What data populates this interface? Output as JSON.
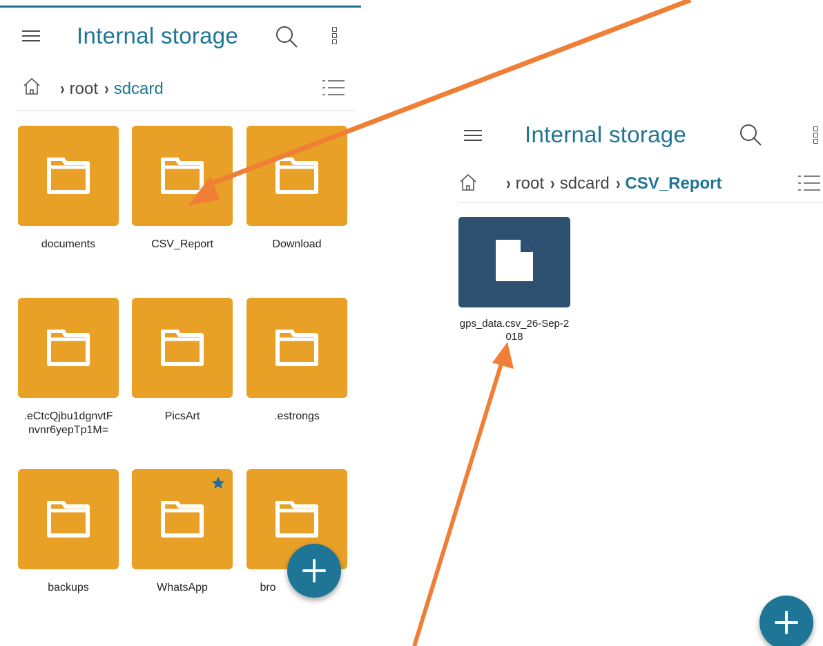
{
  "accent_color": "#1e7595",
  "folder_color": "#e8a027",
  "file_color": "#2d5070",
  "annotation_color": "#f07e35",
  "left_screen": {
    "title": "Internal storage",
    "breadcrumb": [
      "root",
      "sdcard"
    ],
    "folders": [
      {
        "name": "documents"
      },
      {
        "name": "CSV_Report"
      },
      {
        "name": "Download"
      },
      {
        "name": ".eCtcQjbu1dgnvtF nvnr6yepTp1M="
      },
      {
        "name": "PicsArt"
      },
      {
        "name": ".estrongs"
      },
      {
        "name": "backups"
      },
      {
        "name": "WhatsApp",
        "starred": true
      },
      {
        "name": "bro"
      }
    ]
  },
  "right_screen": {
    "title": "Internal storage",
    "breadcrumb": [
      "root",
      "sdcard",
      "CSV_Report"
    ],
    "files": [
      {
        "name": "gps_data.csv_26-Sep-2018"
      }
    ]
  }
}
